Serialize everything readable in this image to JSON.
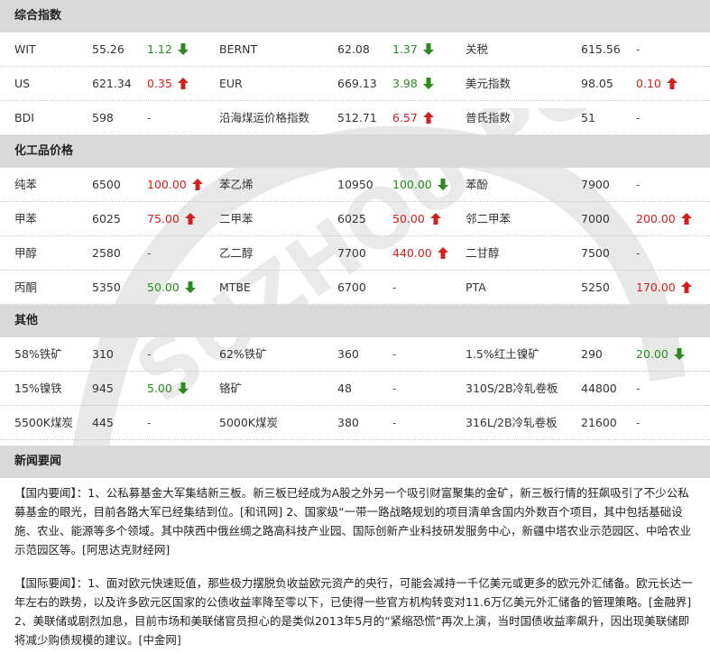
{
  "sections": {
    "composite": {
      "title": "综合指数",
      "rows": [
        [
          {
            "name": "WIT",
            "price": "55.26",
            "change": "1.12",
            "dir": "down"
          },
          {
            "name": "BERNT",
            "price": "62.08",
            "change": "1.37",
            "dir": "down"
          },
          {
            "name": "关税",
            "price": "615.56",
            "change": "-",
            "dir": "none"
          }
        ],
        [
          {
            "name": "US",
            "price": "621.34",
            "change": "0.35",
            "dir": "up"
          },
          {
            "name": "EUR",
            "price": "669.13",
            "change": "3.98",
            "dir": "down"
          },
          {
            "name": "美元指数",
            "price": "98.05",
            "change": "0.10",
            "dir": "up"
          }
        ],
        [
          {
            "name": "BDI",
            "price": "598",
            "change": "-",
            "dir": "none"
          },
          {
            "name": "沿海煤运价格指数",
            "price": "512.71",
            "change": "6.57",
            "dir": "up"
          },
          {
            "name": "普氏指数",
            "price": "51",
            "change": "-",
            "dir": "none"
          }
        ]
      ]
    },
    "chemical": {
      "title": "化工品价格",
      "rows": [
        [
          {
            "name": "纯苯",
            "price": "6500",
            "change": "100.00",
            "dir": "up"
          },
          {
            "name": "苯乙烯",
            "price": "10950",
            "change": "100.00",
            "dir": "down"
          },
          {
            "name": "苯酚",
            "price": "7900",
            "change": "-",
            "dir": "none"
          }
        ],
        [
          {
            "name": "甲苯",
            "price": "6025",
            "change": "75.00",
            "dir": "up"
          },
          {
            "name": "二甲苯",
            "price": "6025",
            "change": "50.00",
            "dir": "up"
          },
          {
            "name": "邻二甲苯",
            "price": "7000",
            "change": "200.00",
            "dir": "up"
          }
        ],
        [
          {
            "name": "甲醇",
            "price": "2580",
            "change": "-",
            "dir": "none"
          },
          {
            "name": "乙二醇",
            "price": "7700",
            "change": "440.00",
            "dir": "up"
          },
          {
            "name": "二甘醇",
            "price": "7500",
            "change": "-",
            "dir": "none"
          }
        ],
        [
          {
            "name": "丙酮",
            "price": "5350",
            "change": "50.00",
            "dir": "down"
          },
          {
            "name": "MTBE",
            "price": "6700",
            "change": "-",
            "dir": "none"
          },
          {
            "name": "PTA",
            "price": "5250",
            "change": "170.00",
            "dir": "up"
          }
        ]
      ]
    },
    "other": {
      "title": "其他",
      "rows": [
        [
          {
            "name": "58%铁矿",
            "price": "310",
            "change": "-",
            "dir": "none"
          },
          {
            "name": "62%铁矿",
            "price": "360",
            "change": "-",
            "dir": "none"
          },
          {
            "name": "1.5%红土镍矿",
            "price": "290",
            "change": "20.00",
            "dir": "down"
          }
        ],
        [
          {
            "name": "15%镍铁",
            "price": "945",
            "change": "5.00",
            "dir": "down"
          },
          {
            "name": "铬矿",
            "price": "48",
            "change": "-",
            "dir": "none"
          },
          {
            "name": "310S/2B冷轧卷板",
            "price": "44800",
            "change": "-",
            "dir": "none"
          }
        ],
        [
          {
            "name": "5500K煤炭",
            "price": "445",
            "change": "-",
            "dir": "none"
          },
          {
            "name": "5000K煤炭",
            "price": "380",
            "change": "-",
            "dir": "none"
          },
          {
            "name": "316L/2B冷轧卷板",
            "price": "21600",
            "change": "-",
            "dir": "none"
          }
        ]
      ]
    }
  },
  "news": {
    "title": "新闻要闻",
    "domestic": "【国内要闻】：1、公私募基金大军集结新三板。新三板已经成为A股之外另一个吸引财富聚集的金矿，新三板行情的狂飙吸引了不少公私募基金的眼光，目前各路大军已经集结到位。[和讯网] 2、国家级“一带一路战略规划的项目清单含国内外数百个项目，其中包括基础设施、农业、能源等多个领域。其中陕西中俄丝绸之路高科技产业园、国际创新产业科技研发服务中心，新疆中塔农业示范园区、中哈农业示范园区等。[阿思达克财经网]",
    "international": "【国际要闻】：1、面对欧元快速贬值，那些极力摆脱负收益欧元资产的央行，可能会减持一千亿美元或更多的欧元外汇储备。欧元长达一年左右的跌势，以及许多欧元区国家的公债收益率降至零以下，已使得一些官方机构转变对11.6万亿美元外汇储备的管理策略。[金融界] 2、美联储或剧烈加息，目前市场和美联储官员担心的是类似2013年5月的“紧缩恐慌”再次上演，当时国债收益率飙升，因出现美联储即将减少购债规模的建议。[中金网]"
  },
  "watermark": {
    "text": "SUZHOU PORT"
  },
  "colors": {
    "up": "#d02020",
    "down": "#2a8a1f",
    "header_bg": "#d9d9d9"
  }
}
